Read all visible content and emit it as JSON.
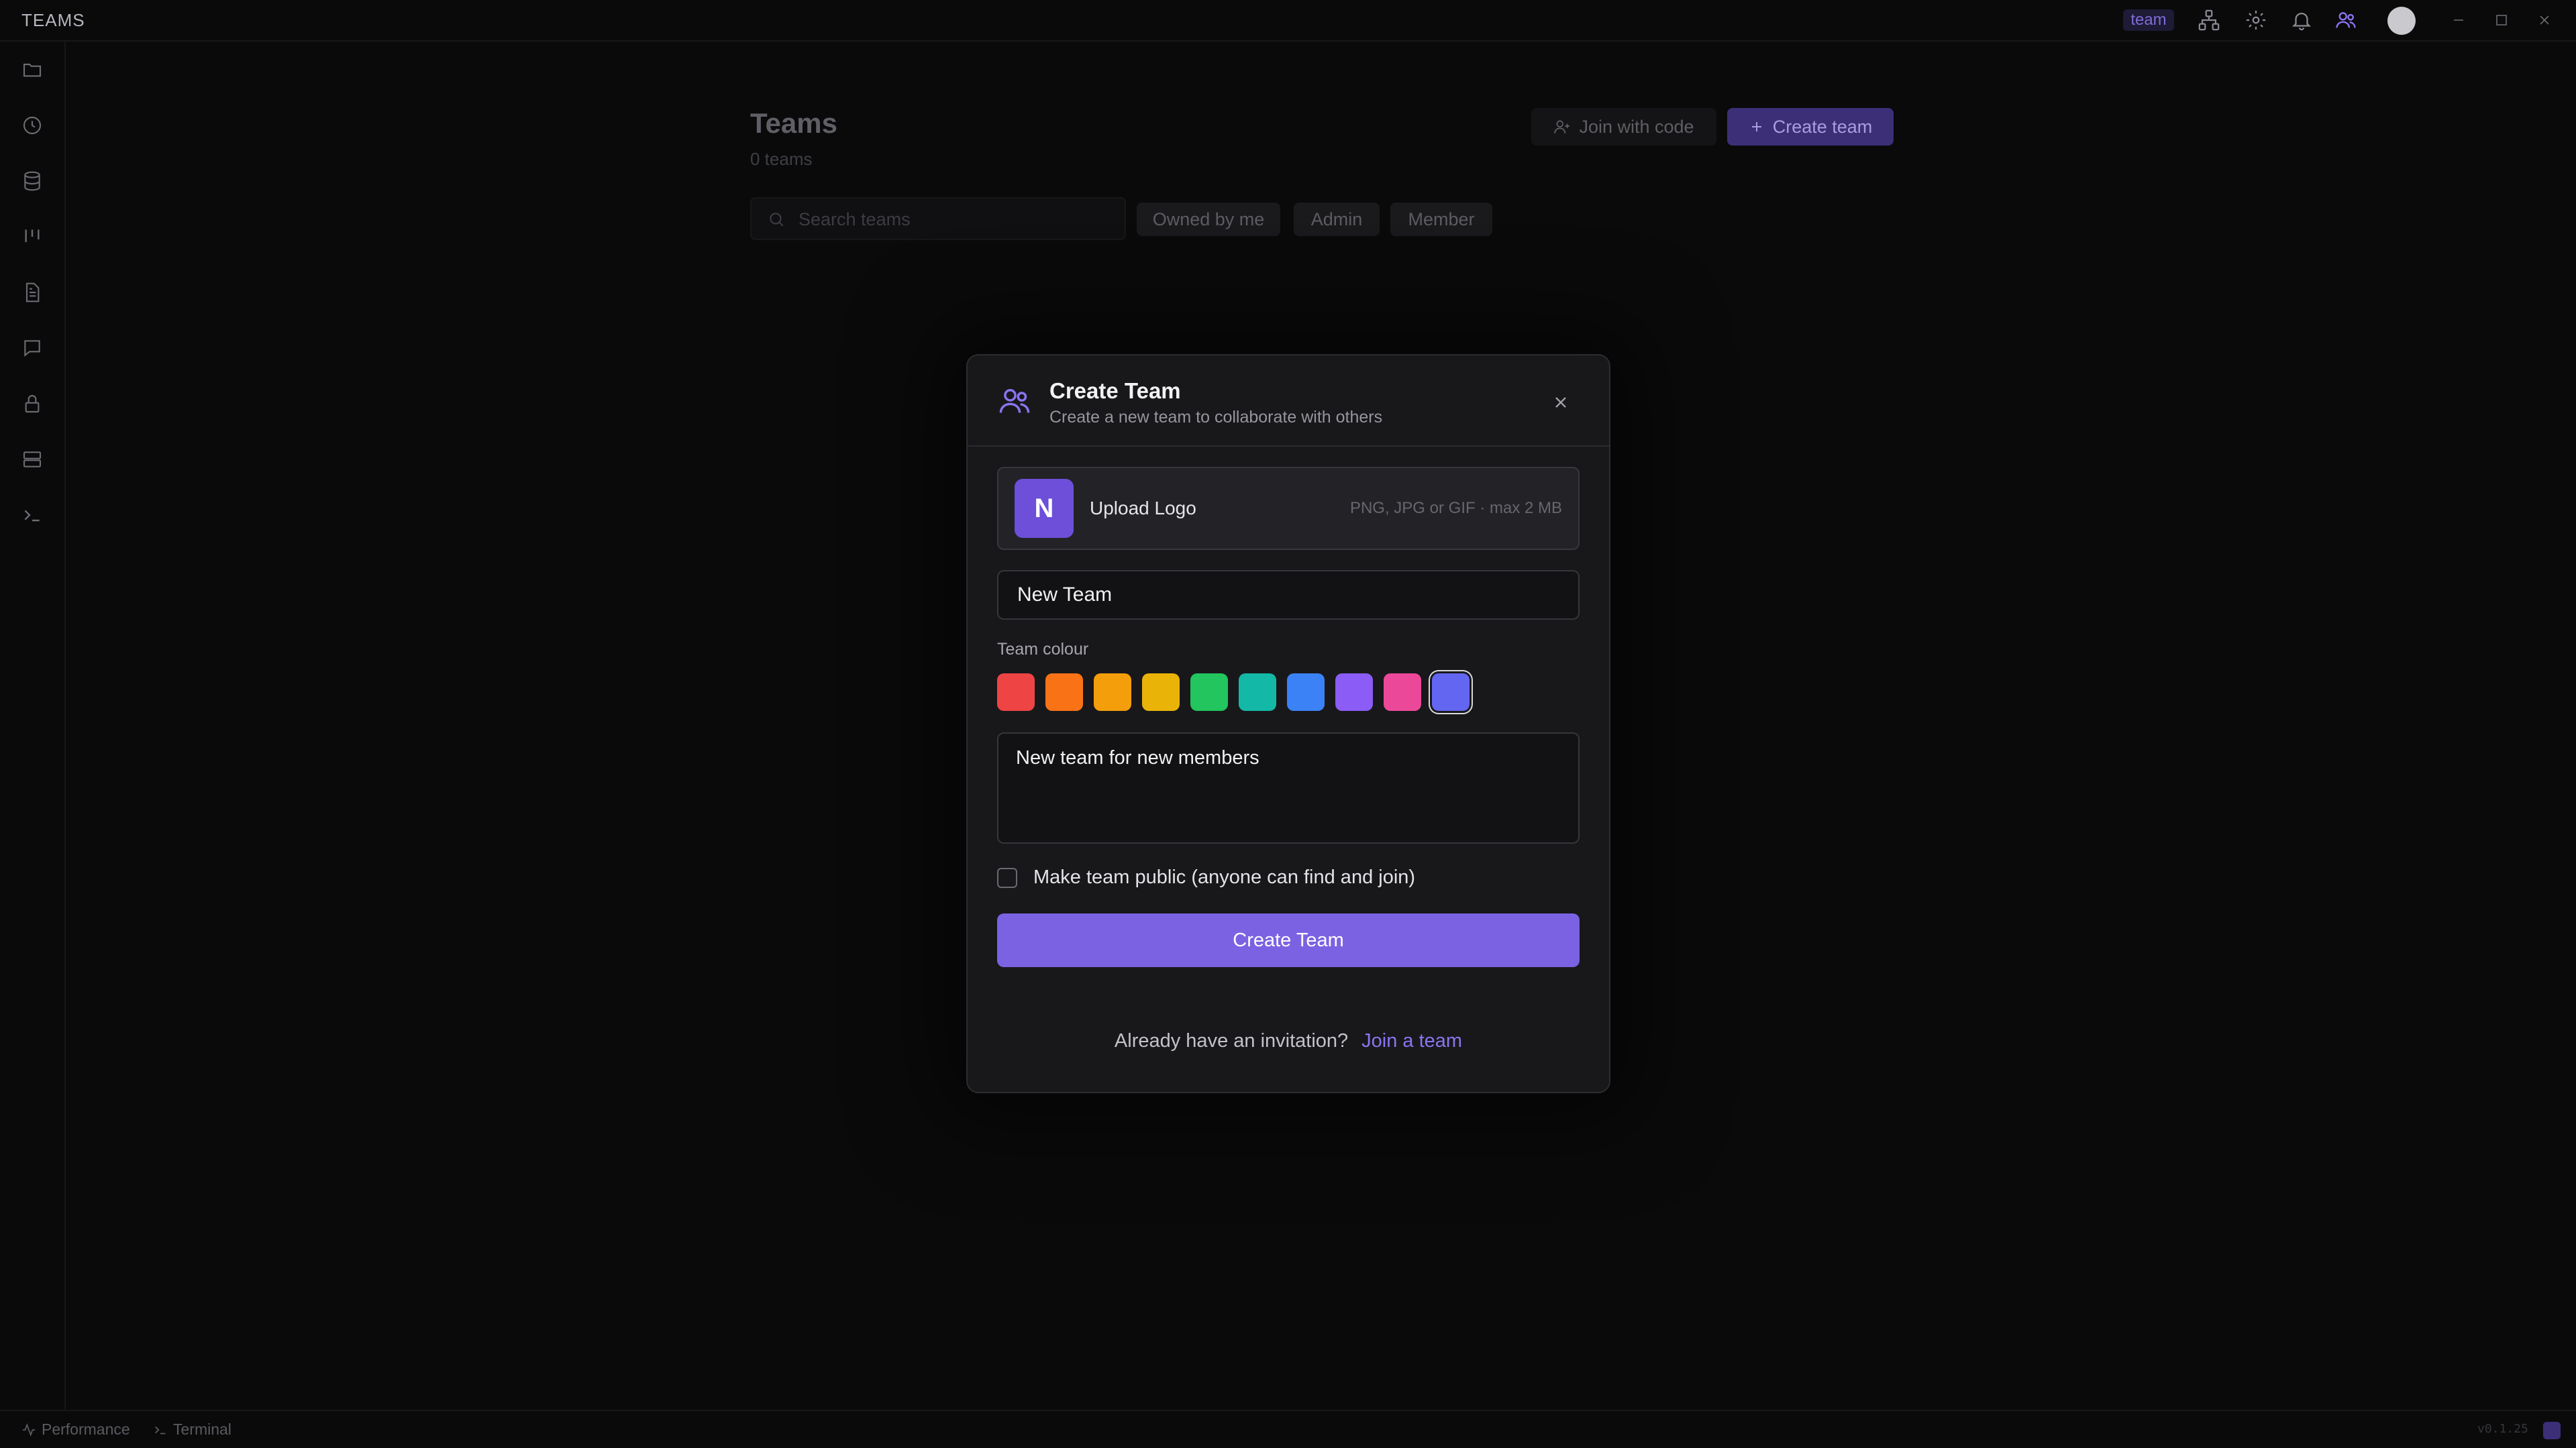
{
  "app": {
    "title": "TEAMS"
  },
  "titlebar": {
    "badge": "team",
    "icons": [
      "network-icon",
      "gear-icon",
      "bell-icon",
      "users-icon",
      "avatar"
    ],
    "window_controls": [
      "minimize-icon",
      "maximize-icon",
      "close-icon"
    ]
  },
  "sidebar": {
    "items": [
      "folder-icon",
      "clock-icon",
      "database-icon",
      "kanban-icon",
      "document-icon",
      "chat-icon",
      "lock-icon",
      "server-icon",
      "terminal-icon"
    ]
  },
  "page": {
    "title": "Teams",
    "count": "0 teams",
    "join_button": "Join with code",
    "create_button": "Create team",
    "search_placeholder": "Search teams",
    "filters": [
      "Owned by me",
      "Admin",
      "Member"
    ]
  },
  "modal": {
    "title": "Create Team",
    "subtitle": "Create a new team to collaborate with others",
    "upload_label": "Upload Logo",
    "upload_hint": "PNG, JPG or GIF · max 2 MB",
    "logo_letter": "N",
    "name_value": "New Team",
    "colour_label": "Team colour",
    "colours": [
      "#ef4444",
      "#f97316",
      "#f59e0b",
      "#eab308",
      "#22c55e",
      "#14b8a6",
      "#3b82f6",
      "#8b5cf6",
      "#ec4899",
      "#6366f1"
    ],
    "selected_colour": "#6366f1",
    "description_value": "New team for new members",
    "public_label": "Make team public (anyone can find and join)",
    "public_checked": false,
    "submit_label": "Create Team",
    "invite_text": "Already have an invitation?",
    "invite_link": "Join a team"
  },
  "statusbar": {
    "performance": "Performance",
    "terminal": "Terminal",
    "version": "v0.1.25"
  },
  "colors": {
    "accent": "#7b62e3",
    "link": "#8b74f0",
    "background": "#0a0a0b",
    "modal_bg": "#18181b"
  }
}
